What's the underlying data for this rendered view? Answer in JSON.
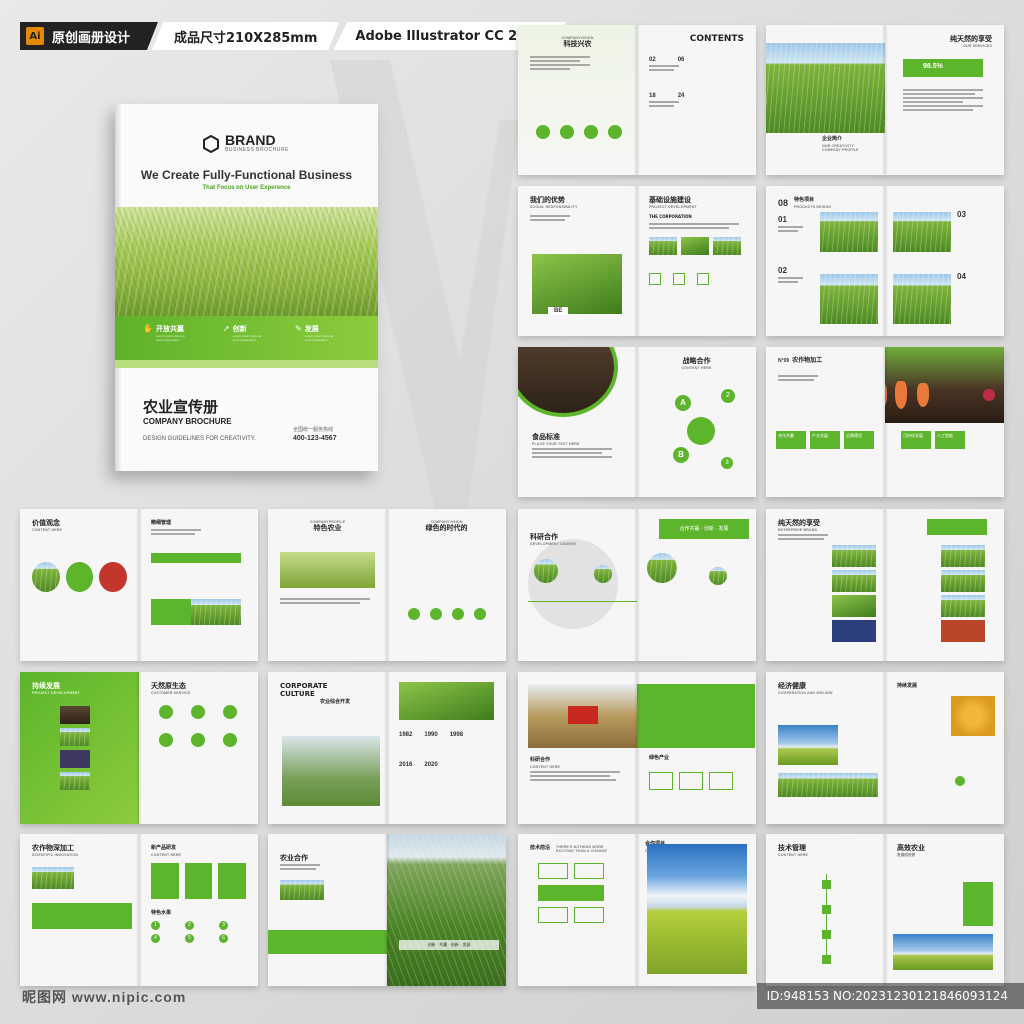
{
  "tags": {
    "ai_badge": "Ai",
    "original_label": "原创画册设计",
    "size_label": "成品尺寸210X285mm",
    "software_label": "Adobe Illustrator CC 2018"
  },
  "cover": {
    "brand": "BRAND",
    "brand_sub": "BUSINESS BROCHURE",
    "headline": "We Create Fully-Functional Business",
    "subheadline": "That Focus on User Experence",
    "band_items": [
      {
        "label": "开放共赢",
        "icon": "hands-icon",
        "text": "Lorem ipsum dolor sit amet consectetur"
      },
      {
        "label": "创新",
        "icon": "rocket-icon",
        "text": "Lorem ipsum dolor sit amet consectetur"
      },
      {
        "label": "发展",
        "icon": "growth-icon",
        "text": "Lorem ipsum dolor sit amet consectetur"
      }
    ],
    "title": "农业宣传册",
    "title_en": "COMPANY BROCHURE",
    "guideline": "DESIGN GUIDELINES FOR CREATIVITY.",
    "hotline_label": "全国统一服务热线",
    "hotline": "400-123-4567"
  },
  "spreads": {
    "contents": {
      "left_title": "科技兴农",
      "left_sub": "COMPANYVISION",
      "right_title": "CONTENTS",
      "nums": [
        "02",
        "06",
        "18",
        "24"
      ]
    },
    "services": {
      "title": "纯天然的享受",
      "sub": "OUR SERVICES",
      "percent": "98.5%",
      "caption": "企业简介",
      "caption_sub": "OUR CREATIVITY COMPANY PROFILE"
    },
    "social": {
      "left_title": "我们的优势",
      "left_sub": "SOCIAL RESPONSIBILITY",
      "left_box": "BE",
      "right_title": "基础设施建设",
      "right_sub": "PROJECT DEVELOPMENT",
      "right_heading": "THE CORPORATION"
    },
    "products": {
      "num": "08",
      "title": "特色项目",
      "sub": "PRODUCTS DESIGN",
      "items": [
        "01",
        "02",
        "03",
        "04"
      ]
    },
    "strategy": {
      "left_title": "食品标准",
      "left_sub": "PLACE YOUR TEXT HERE",
      "right_title": "战略合作",
      "right_sub": "CONTENT HERE",
      "letters": [
        "A",
        "B"
      ],
      "nums": [
        "2",
        "3"
      ]
    },
    "processing": {
      "num": "N°09",
      "title": "农作物加工",
      "tags": [
        "合作共赢",
        "产业发展",
        "品牌建设",
        "可持续发展",
        "人工智能"
      ]
    },
    "value": {
      "title": "价值观念",
      "sub": "CONTENT HERE",
      "right_title": "精细管理"
    },
    "profile": {
      "left_sub": "COMPANYPROFILE",
      "left_title": "特色农业",
      "right_sub": "COMPANYVISION",
      "right_title": "绿色的时代的"
    },
    "research": {
      "title": "科研合作",
      "sub": "DEVELOPMENT COURSE",
      "banner": "合作共赢 · 创新 · 发展"
    },
    "brand": {
      "title": "纯天然的享受",
      "sub": "ENTERPRISE BRAND"
    },
    "sustain": {
      "left_title": "持续发展",
      "left_sub": "PROJECT DEVELOPMENT",
      "right_title": "天然原生态",
      "right_sub": "CUSTOMER SERVICE"
    },
    "culture": {
      "title_en": "CORPORATE CULTURE",
      "title": "农业综合开发",
      "years": [
        "1982",
        "1990",
        "1998",
        "2016",
        "2020"
      ]
    },
    "green": {
      "title": "科研合作",
      "sub": "CONTENT HERE",
      "right_title": "绿色产业"
    },
    "economy": {
      "title": "经济健康",
      "sub": "COOPERATION AND WIN-WIN",
      "right_title": "持续发展"
    },
    "deep": {
      "left_title": "农作物深加工",
      "left_sub": "SCIENTIFIC INNOVATION",
      "right_title": "新产品研发",
      "right_sub": "CONTENT HERE",
      "right_title2": "特色水果",
      "nums": [
        "1",
        "2",
        "3",
        "4",
        "5",
        "6"
      ]
    },
    "coop": {
      "title": "农业合作",
      "banner": "创新 · 共赢 · 创新 · 发展"
    },
    "tech": {
      "title": "技术前沿",
      "sub": "THERE'S NOTHING MORE EXCITING THAN A CHANGE",
      "right_title": "合作项目",
      "right_sub": "CONTENT HERE"
    },
    "manage": {
      "title": "技术管理",
      "sub": "CONTENT HERE",
      "right_title": "高效农业",
      "right_sub": "发展的优势"
    }
  },
  "footer": {
    "site": "昵图网 www.nipic.com",
    "id_text": "ID:948153 NO:20231230121846093124"
  },
  "colors": {
    "accent": "#5cb52a",
    "accent_light": "#8ccc3d",
    "dark": "#222222"
  }
}
